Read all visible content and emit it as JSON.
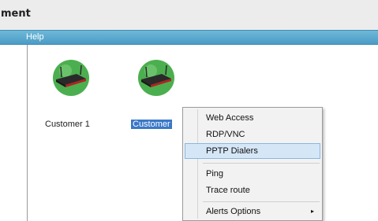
{
  "window": {
    "title": "ment"
  },
  "menubar": {
    "items": [
      "Help"
    ]
  },
  "devices": [
    {
      "label": "Customer 1",
      "selected": false
    },
    {
      "label": "Customer",
      "selected": true
    }
  ],
  "context_menu": {
    "items": [
      {
        "label": "Web Access",
        "highlighted": false
      },
      {
        "label": "RDP/VNC",
        "highlighted": false
      },
      {
        "label": "PPTP Dialers",
        "highlighted": true
      },
      {
        "label": "Ping",
        "highlighted": false
      },
      {
        "label": "Trace route",
        "highlighted": false
      },
      {
        "label": "Alerts Options",
        "highlighted": false,
        "submenu": true
      }
    ],
    "submenu_arrow": "▸"
  },
  "icons": {
    "device_icon": "router-icon",
    "submenu_indicator": "chevron-right-icon"
  },
  "colors": {
    "menubar": "#4a9cc6",
    "router_globe": "#4caf4f",
    "router_body": "#2a2a2a",
    "router_accent": "#b22222",
    "selection": "#3a78c8",
    "menu_highlight": "#d5e7f7"
  }
}
